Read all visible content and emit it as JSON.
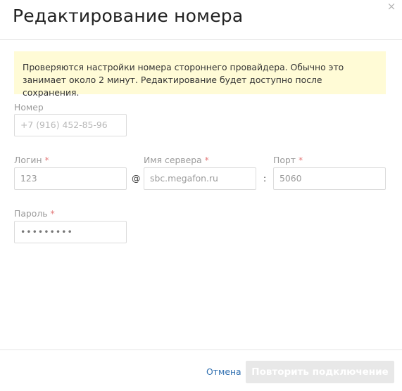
{
  "dialog": {
    "title": "Редактирование номера",
    "close_symbol": "×"
  },
  "notice": {
    "text": "Проверяются настройки номера стороннего провайдера. Обычно это занимает около 2 минут. Редактирование будет доступно после сохранения."
  },
  "form": {
    "number": {
      "label": "Номер",
      "placeholder": "+7 (916) 452-85-96"
    },
    "login": {
      "label": "Логин",
      "required_mark": "*",
      "value": "123"
    },
    "at_sign": "@",
    "server": {
      "label": "Имя сервера",
      "required_mark": "*",
      "value": "sbc.megafon.ru"
    },
    "colon": ":",
    "port": {
      "label": "Порт",
      "required_mark": "*",
      "value": "5060"
    },
    "password": {
      "label": "Пароль",
      "required_mark": "*",
      "value": "•••••••••"
    }
  },
  "footer": {
    "cancel_label": "Отмена",
    "retry_label": "Повторить подключение"
  },
  "colors": {
    "notice_bg": "#fffbd6",
    "required": "#e47a7a",
    "link": "#2f6fb0",
    "disabled_button": "#e8e8e8"
  },
  "icons": {
    "close": "close-icon"
  }
}
